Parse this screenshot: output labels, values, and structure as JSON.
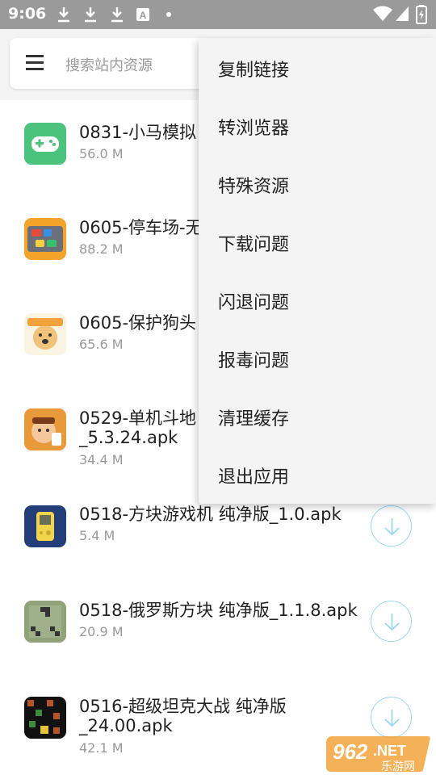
{
  "status_bar": {
    "time": "9:06",
    "notification_icons": [
      "download-icon",
      "download-icon",
      "download-icon",
      "translate-icon",
      "dot-icon"
    ],
    "right_icons": [
      "wifi-icon",
      "signal-icon",
      "battery-charging-icon"
    ]
  },
  "search": {
    "placeholder": "搜索站内资源"
  },
  "menu": {
    "items": [
      {
        "label": "复制链接"
      },
      {
        "label": "转浏览器"
      },
      {
        "label": "特殊资源"
      },
      {
        "label": "下载问题"
      },
      {
        "label": "闪退问题"
      },
      {
        "label": "报毒问题"
      },
      {
        "label": "清理缓存"
      },
      {
        "label": "退出应用"
      }
    ]
  },
  "list": {
    "items": [
      {
        "title": "0831-小马模拟",
        "size": "56.0 M",
        "icon": "gamepad-icon"
      },
      {
        "title": "0605-停车场-无",
        "size": "88.2 M",
        "icon": "parking-game-icon"
      },
      {
        "title": "0605-保护狗头",
        "size": "65.6 M",
        "icon": "doge-game-icon"
      },
      {
        "title": "0529-单机斗地",
        "title2": "_5.3.24.apk",
        "size": "34.4 M",
        "icon": "doudizhu-game-icon"
      },
      {
        "title": "0518-方块游戏机 纯净版_1.0.apk",
        "size": "5.4 M",
        "icon": "brick-game-icon"
      },
      {
        "title": "0518-俄罗斯方块 纯净版_1.1.8.apk",
        "size": "20.9 M",
        "icon": "tetris-icon"
      },
      {
        "title": "0516-超级坦克大战 纯净版",
        "title2": "_24.00.apk",
        "size": "42.1 M",
        "icon": "tank-game-icon"
      }
    ]
  },
  "watermark": {
    "number": "962",
    "suffix": ".NET",
    "text": "乐游网"
  },
  "colors": {
    "status_bar": "#9a9a9a",
    "accent_download": "#9ad7ef",
    "gamepad_green": "#4cc27c"
  }
}
